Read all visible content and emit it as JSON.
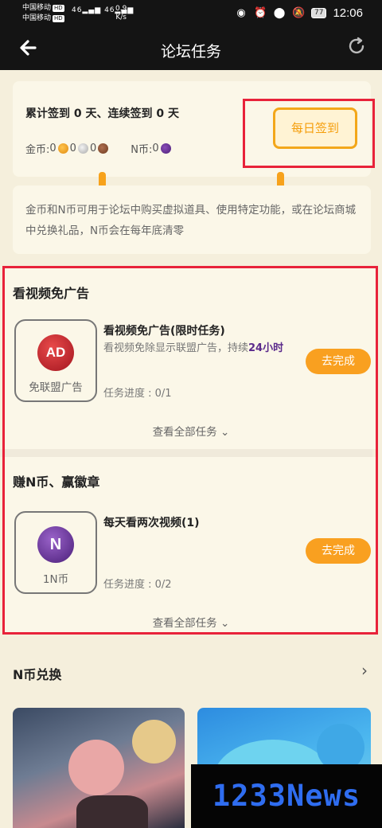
{
  "status_bar": {
    "carrier1": "中国移动",
    "carrier2": "中国移动",
    "hd": "HD",
    "net": "46",
    "speed_value": "0.9",
    "speed_unit": "K/s",
    "battery": "77",
    "time": "12:06",
    "icons": [
      "eye-icon",
      "alarm-icon",
      "location-icon",
      "mute-icon"
    ]
  },
  "nav": {
    "back_icon": "back-arrow-icon",
    "title": "论坛任务",
    "refresh_icon": "refresh-icon"
  },
  "checkin": {
    "summary": "累计签到 0 天、连续签到 0 天",
    "coins_label": "金币: ",
    "gold_count": "0",
    "silver_count": "0",
    "bronze_count": "0",
    "n_label": "N币: ",
    "n_count": "0",
    "button_label": "每日签到"
  },
  "info": {
    "text": "金币和N币可用于论坛中购买虚拟道具、使用特定功能，或在论坛商城中兑换礼品，N币会在每年底清零"
  },
  "sections": [
    {
      "title": "看视频免广告",
      "task": {
        "badge_text": "AD",
        "badge_caption": "免联盟广告",
        "title": "看视频免广告(限时任务)",
        "desc_prefix": "看视频免除显示联盟广告，持续",
        "desc_highlight": "24小时",
        "progress": "任务进度 : 0/1",
        "button": "去完成"
      },
      "view_all": "查看全部任务"
    },
    {
      "title": "赚N币、赢徽章",
      "task": {
        "badge_text": "N",
        "badge_caption": "1N币",
        "title": "每天看两次视频(1)",
        "progress": "任务进度 : 0/2",
        "button": "去完成"
      },
      "view_all": "查看全部任务"
    }
  ],
  "exchange": {
    "title": "N币兑换",
    "arrow": "›"
  },
  "watermark": "1233News",
  "colors": {
    "accent": "#f9a020",
    "highlight": "#5b2a8c",
    "annotation_red": "#e8223a",
    "background": "#f5efdc"
  }
}
